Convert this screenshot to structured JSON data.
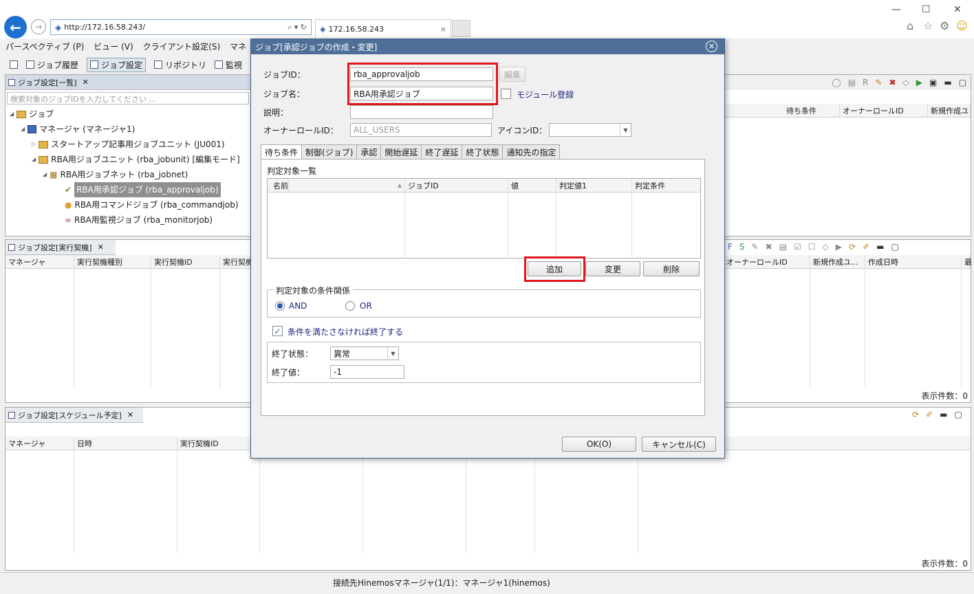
{
  "browser": {
    "url": "http://172.16.58.243/",
    "tab_title": "172.16.58.243",
    "tab_close": "×",
    "back": "←",
    "forward": "→",
    "window_controls": [
      "—",
      "☐",
      "✕"
    ],
    "right_icons": [
      "⌂",
      "☆",
      "⚙",
      "☺"
    ]
  },
  "menu": [
    "パースペクティブ (P)",
    "ビュー (V)",
    "クライアント設定(S)",
    "マネ"
  ],
  "toolbar": [
    "ジョブ履歴",
    "ジョブ設定",
    "リポジトリ",
    "監視"
  ],
  "tree_panel": {
    "tab": "ジョブ設定[一覧]",
    "search_placeholder": "検索対象のジョブIDを入力してください ...",
    "nodes": [
      "ジョブ",
      "マネージャ (マネージャ1)",
      "スタートアップ記事用ジョブユニット (JU001)",
      "RBA用ジョブユニット (rba_jobunit) [編集モード]",
      "RBA用ジョブネット (rba_jobnet)",
      "RBA用承認ジョブ (rba_approvaljob)",
      "RBA用コマンドジョブ (rba_commandjob)",
      "RBA用監視ジョブ (rba_monitorjob)"
    ]
  },
  "right_top_headers": [
    "待ち条件",
    "オーナーロールID",
    "新規作成ユ"
  ],
  "exec_panel": {
    "tab": "ジョブ設定[実行契機]",
    "headers": [
      "マネージャ",
      "実行契機種別",
      "実行契機ID",
      "実行契機"
    ],
    "right_headers": [
      "オーナーロールID",
      "新規作成ユ...",
      "作成日時",
      "最"
    ],
    "count": "表示件数：0"
  },
  "schedule_panel": {
    "tab": "ジョブ設定[スケジュール予定]",
    "headers": [
      "マネージャ",
      "日時",
      "実行契機ID"
    ],
    "count": "表示件数：0"
  },
  "status_bar": "接続先Hinemosマネージャ(1/1)：マネージャ1(hinemos)",
  "dialog": {
    "title": "ジョブ[承認ジョブの作成・変更]",
    "close": "✕",
    "job_id_label": "ジョブID：",
    "job_id_value": "rba_approvaljob",
    "edit_button": "編集",
    "job_name_label": "ジョブ名：",
    "job_name_value": "RBA用承認ジョブ",
    "module_label": "モジュール登録",
    "desc_label": "説明：",
    "desc_value": "",
    "owner_label": "オーナーロールID：",
    "owner_value": "ALL_USERS",
    "icon_label": "アイコンID：",
    "icon_value": "",
    "tabs": [
      "待ち条件",
      "制御(ジョブ)",
      "承認",
      "開始遅延",
      "終了遅延",
      "終了状態",
      "通知先の指定"
    ],
    "list_title": "判定対象一覧",
    "list_headers": [
      "名前",
      "ジョブID",
      "値",
      "判定値1",
      "判定条件"
    ],
    "add_button": "追加",
    "modify_button": "変更",
    "delete_button": "削除",
    "cond_group": "判定対象の条件関係",
    "and_label": "AND",
    "or_label": "OR",
    "end_check_label": "条件を満たさなければ終了する",
    "end_status_label": "終了状態：",
    "end_status_value": "異常",
    "end_value_label": "終了値：",
    "end_value": "-1",
    "ok_button": "OK(O)",
    "cancel_button": "キャンセル(C)"
  },
  "colors": {
    "dialog_title": "#4f6f98",
    "highlight": "#e0161c",
    "accent": "#1e6fd0"
  }
}
